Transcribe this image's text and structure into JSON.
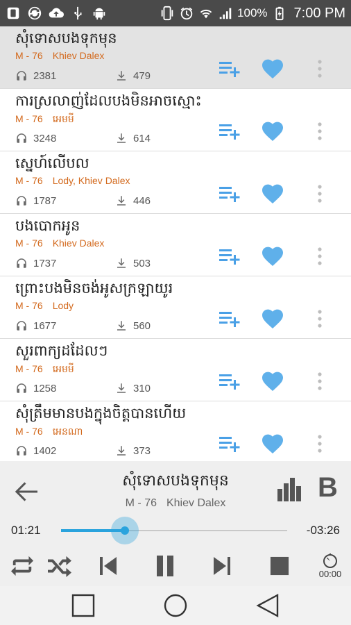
{
  "status_bar": {
    "battery": "100%",
    "time": "7:00 PM",
    "icons": [
      "app-icon",
      "sync-icon",
      "cloud-upload-icon",
      "usb-icon",
      "android-icon",
      "phone-vibrate-icon",
      "alarm-icon",
      "wifi-icon",
      "signal-icon",
      "battery-charging-icon"
    ]
  },
  "songs": [
    {
      "title": "សុំទោសបងទុកមុន",
      "album": "M - 76",
      "artist": "Khiev Dalex",
      "listens": "2381",
      "downloads": "479",
      "active": true
    },
    {
      "title": "ការស្រលាញ់ដែលបងមិនអាចស្មោះ",
      "album": "M - 76",
      "artist": "អេមមី",
      "listens": "3248",
      "downloads": "614",
      "active": false
    },
    {
      "title": "ស្នេហ៍លើបល",
      "album": "M - 76",
      "artist": "Lody, Khiev Dalex",
      "listens": "1787",
      "downloads": "446",
      "active": false
    },
    {
      "title": "បងបោកអូន",
      "album": "M - 76",
      "artist": "Khiev Dalex",
      "listens": "1737",
      "downloads": "503",
      "active": false
    },
    {
      "title": "ព្រោះបងមិនចង់អូសក្រឡាយូរ",
      "album": "M - 76",
      "artist": "Lody",
      "listens": "1677",
      "downloads": "560",
      "active": false
    },
    {
      "title": "សួរពាក្យដដែលៗ",
      "album": "M - 76",
      "artist": "អេមមី",
      "listens": "1258",
      "downloads": "310",
      "active": false
    },
    {
      "title": "សុំត្រឹមមានបងក្នុងចិត្តបានហើយ",
      "album": "M - 76",
      "artist": "អេនណា",
      "listens": "1402",
      "downloads": "373",
      "active": false
    }
  ],
  "player": {
    "title": "សុំទោសបងទុកមុន",
    "album": "M - 76",
    "artist": "Khiev Dalex",
    "current_time": "01:21",
    "remaining_time": "-03:26",
    "progress": 0.283,
    "sleep_timer": "00:00",
    "b_label": "B"
  },
  "colors": {
    "accent": "#2aa3dd",
    "heart": "#5fb0ea",
    "add_icon": "#4aa0e6",
    "meta_orange": "#d36a1e"
  }
}
